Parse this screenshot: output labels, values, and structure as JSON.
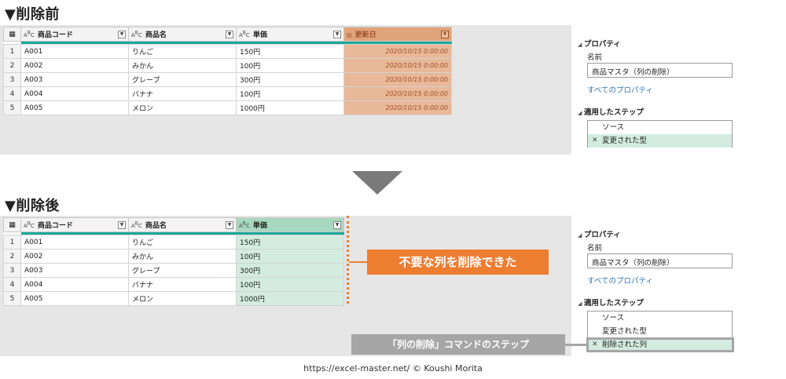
{
  "before": {
    "title": "▼削除前",
    "columns": [
      {
        "type_icon": "ABC",
        "label": "商品コード"
      },
      {
        "type_icon": "ABC",
        "label": "商品名"
      },
      {
        "type_icon": "ABC",
        "label": "単価"
      },
      {
        "type_icon": "calendar-icon",
        "label": "更新日"
      }
    ],
    "rows": [
      {
        "n": "1",
        "code": "A001",
        "name": "りんご",
        "price": "150円",
        "date": "2020/10/15 0:00:00"
      },
      {
        "n": "2",
        "code": "A002",
        "name": "みかん",
        "price": "100円",
        "date": "2020/10/15 0:00:00"
      },
      {
        "n": "3",
        "code": "A003",
        "name": "グレープ",
        "price": "300円",
        "date": "2020/10/15 0:00:00"
      },
      {
        "n": "4",
        "code": "A004",
        "name": "バナナ",
        "price": "100円",
        "date": "2020/10/15 0:00:00"
      },
      {
        "n": "5",
        "code": "A005",
        "name": "メロン",
        "price": "1000円",
        "date": "2020/10/15 0:00:00"
      }
    ],
    "properties": {
      "header": "プロパティ",
      "name_label": "名前",
      "name_value": "商品マスタ（列の削除）",
      "all_props": "すべてのプロパティ",
      "steps_header": "適用したステップ",
      "steps": [
        "ソース",
        "変更された型"
      ]
    }
  },
  "after": {
    "title": "▼削除後",
    "columns": [
      {
        "type_icon": "ABC",
        "label": "商品コード"
      },
      {
        "type_icon": "ABC",
        "label": "商品名"
      },
      {
        "type_icon": "ABC",
        "label": "単価"
      }
    ],
    "rows": [
      {
        "n": "1",
        "code": "A001",
        "name": "りんご",
        "price": "150円"
      },
      {
        "n": "2",
        "code": "A002",
        "name": "みかん",
        "price": "100円"
      },
      {
        "n": "3",
        "code": "A003",
        "name": "グレープ",
        "price": "300円"
      },
      {
        "n": "4",
        "code": "A004",
        "name": "バナナ",
        "price": "100円"
      },
      {
        "n": "5",
        "code": "A005",
        "name": "メロン",
        "price": "1000円"
      }
    ],
    "properties": {
      "header": "プロパティ",
      "name_label": "名前",
      "name_value": "商品マスタ（列の削除）",
      "all_props": "すべてのプロパティ",
      "steps_header": "適用したステップ",
      "steps": [
        "ソース",
        "変更された型",
        "削除された列"
      ]
    }
  },
  "callouts": {
    "removed": "不要な列を削除できた",
    "command_step": "「列の削除」コマンドのステップ"
  },
  "footer": "https://excel-master.net/  © Koushi Morita",
  "colors": {
    "accent_teal": "#1aa89a",
    "highlight_orange": "#ed7d31",
    "highlight_green": "#d4ece0",
    "callout_gray": "#a6a6a6",
    "link_blue": "#2e74b5"
  }
}
